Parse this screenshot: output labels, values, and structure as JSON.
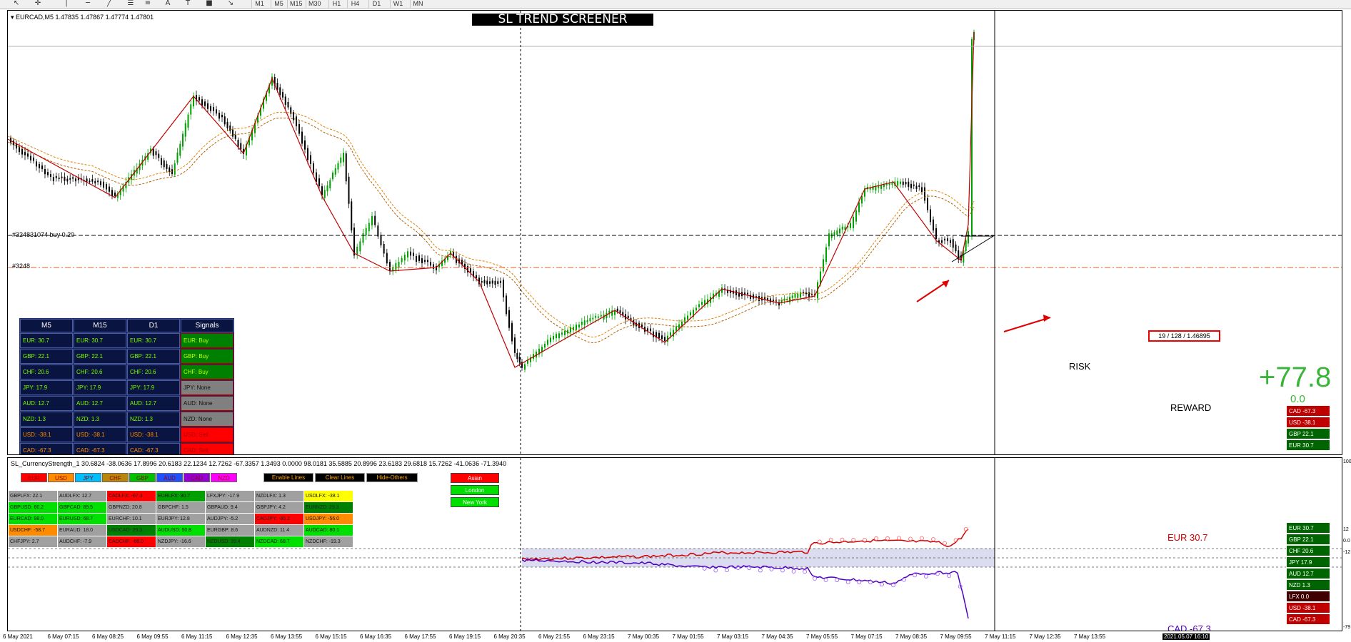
{
  "toolbar": {
    "tools": [
      {
        "icon": "cursor-icon",
        "glyph": "↖"
      },
      {
        "icon": "crosshair-icon",
        "glyph": "✛"
      },
      {
        "icon": "vertical-line-icon",
        "glyph": "│"
      },
      {
        "icon": "horizontal-line-icon",
        "glyph": "─"
      },
      {
        "icon": "trendline-icon",
        "glyph": "╱"
      },
      {
        "icon": "fibonacci-icon",
        "glyph": "☰"
      },
      {
        "icon": "channel-icon",
        "glyph": "≡"
      },
      {
        "icon": "text-icon",
        "glyph": "A"
      },
      {
        "icon": "label-icon",
        "glyph": "T"
      },
      {
        "icon": "shapes-icon",
        "glyph": "■"
      },
      {
        "icon": "arrows-icon",
        "glyph": "↘"
      }
    ],
    "timeframes": [
      "M1",
      "M5",
      "M15",
      "M30",
      "H1",
      "H4",
      "D1",
      "W1",
      "MN"
    ]
  },
  "main": {
    "symbol_info": "▾ EURCAD,M5  1.47835 1.47867 1.47774 1.47801",
    "screener_title": "SL TREND SCREENER",
    "order_buy_label": "#324831074 buy 0.20",
    "order_sl_label": "#3248",
    "risk_box_text": "19 / 128 / 1.46895",
    "risk_label": "RISK",
    "reward_label": "REWARD",
    "profit_value": "+77.8",
    "profit_sub": "0.0"
  },
  "signals_table": {
    "headers": [
      "M5",
      "M15",
      "D1",
      "Signals"
    ],
    "rows": [
      {
        "m5": "EUR: 30.7",
        "m15": "EUR: 30.7",
        "d1": "EUR: 30.7",
        "signal": "EUR: Buy",
        "signal_color": "#008000"
      },
      {
        "m5": "GBP: 22.1",
        "m15": "GBP: 22.1",
        "d1": "GBP: 22.1",
        "signal": "GBP: Buy",
        "signal_color": "#008000"
      },
      {
        "m5": "CHF: 20.6",
        "m15": "CHF: 20.6",
        "d1": "CHF: 20.6",
        "signal": "CHF: Buy",
        "signal_color": "#008000"
      },
      {
        "m5": "JPY: 17.9",
        "m15": "JPY: 17.9",
        "d1": "JPY: 17.9",
        "signal": "JPY: None",
        "signal_color": "#808080"
      },
      {
        "m5": "AUD: 12.7",
        "m15": "AUD: 12.7",
        "d1": "AUD: 12.7",
        "signal": "AUD: None",
        "signal_color": "#808080"
      },
      {
        "m5": "NZD: 1.3",
        "m15": "NZD: 1.3",
        "d1": "NZD: 1.3",
        "signal": "NZD: None",
        "signal_color": "#808080"
      },
      {
        "m5": "USD: -38.1",
        "m15": "USD: -38.1",
        "d1": "USD: -38.1",
        "signal": "USD: Sell",
        "signal_color": "#ff0000"
      },
      {
        "m5": "CAD: -67.3",
        "m15": "CAD: -67.3",
        "d1": "CAD: -67.3",
        "signal": "CAD: Sell",
        "signal_color": "#ff0000"
      }
    ]
  },
  "strength_panel_main": [
    {
      "label": "CAD  -67.3",
      "color": "#c00000"
    },
    {
      "label": "USD  -38.1",
      "color": "#c00000"
    },
    {
      "label": "GBP  22.1",
      "color": "#006400"
    },
    {
      "label": "EUR  30.7",
      "color": "#006400"
    }
  ],
  "strength_panel_sub": [
    {
      "label": "EUR  30.7",
      "color": "#006400"
    },
    {
      "label": "GBP  22.1",
      "color": "#006400"
    },
    {
      "label": "CHF  20.6",
      "color": "#006400"
    },
    {
      "label": "JPY  17.9",
      "color": "#006400"
    },
    {
      "label": "AUD  12.7",
      "color": "#006400"
    },
    {
      "label": "NZD  1.3",
      "color": "#006400"
    },
    {
      "label": "LFX  0.0",
      "color": "#400000"
    },
    {
      "label": "USD  -38.1",
      "color": "#c00000"
    },
    {
      "label": "CAD  -67.3",
      "color": "#c00000"
    }
  ],
  "sub": {
    "info": "SL_CurrencyStrength_1 30.6824 -38.0636 17.8996 20.6183 22.1234 12.7262 -67.3357 1.3493 0.0000 98.0181 35.5885 20.8996 23.6183 29.6818 15.7262 -41.0636 -71.3940",
    "currency_buttons": [
      {
        "label": "EUR",
        "color": "#ff0000"
      },
      {
        "label": "USD",
        "color": "#ff8c00"
      },
      {
        "label": "JPY",
        "color": "#00bfff"
      },
      {
        "label": "CHF",
        "color": "#b8860b"
      },
      {
        "label": "GBP",
        "color": "#00c000"
      },
      {
        "label": "AUD",
        "color": "#1e50ff"
      },
      {
        "label": "CAD",
        "color": "#9400d3"
      },
      {
        "label": "NZD",
        "color": "#ff00ff"
      }
    ],
    "control_buttons": [
      "Enable Lines",
      "Clear Lines",
      "Hide-Others"
    ],
    "sessions": [
      {
        "label": "Asian",
        "color": "#ff0000"
      },
      {
        "label": "London",
        "color": "#00e000"
      },
      {
        "label": "New York",
        "color": "#00e000"
      }
    ],
    "pairs": [
      [
        {
          "t": "GBPLFX: 22.1",
          "c": "#a0a0a0"
        },
        {
          "t": "AUDLFX: 12.7",
          "c": "#a0a0a0"
        },
        {
          "t": "CADLFX: -67.3",
          "c": "#ff0000"
        },
        {
          "t": "EURLFX: 30.7",
          "c": "#00a000"
        },
        {
          "t": "LFXJPY: -17.9",
          "c": "#a0a0a0"
        },
        {
          "t": "NZDLFX: 1.3",
          "c": "#a0a0a0"
        },
        {
          "t": "USDLFX: -38.1",
          "c": "#ffff00"
        }
      ],
      [
        {
          "t": "GBPUSD: 60.2",
          "c": "#00e000"
        },
        {
          "t": "GBPCAD: 89.5",
          "c": "#00e000"
        },
        {
          "t": "GBPNZD: 20.8",
          "c": "#a0a0a0"
        },
        {
          "t": "GBPCHF: 1.5",
          "c": "#a0a0a0"
        },
        {
          "t": "GBPAUD: 9.4",
          "c": "#a0a0a0"
        },
        {
          "t": "GBPJPY: 4.2",
          "c": "#a0a0a0"
        },
        {
          "t": "EURNZD: 29.3",
          "c": "#008000"
        }
      ],
      [
        {
          "t": "EURCAD: 98.0",
          "c": "#00e000"
        },
        {
          "t": "EURUSD: 68.7",
          "c": "#00e000"
        },
        {
          "t": "EURCHF: 10.1",
          "c": "#a0a0a0"
        },
        {
          "t": "EURJPY: 12.8",
          "c": "#a0a0a0"
        },
        {
          "t": "AUDJPY: -5.2",
          "c": "#a0a0a0"
        },
        {
          "t": "CADJPY: -85.2",
          "c": "#ff0000"
        },
        {
          "t": "USDJPY: -56.0",
          "c": "#ff8c00"
        }
      ],
      [
        {
          "t": "USDCHF: -58.7",
          "c": "#ff8c00"
        },
        {
          "t": "EURAUD: 18.0",
          "c": "#a0a0a0"
        },
        {
          "t": "USDCAD: 29.3",
          "c": "#008000"
        },
        {
          "t": "AUDUSD: 50.8",
          "c": "#00e000"
        },
        {
          "t": "EURGBP: 8.6",
          "c": "#a0a0a0"
        },
        {
          "t": "AUDNZD: 11.4",
          "c": "#a0a0a0"
        },
        {
          "t": "AUDCAD: 80.1",
          "c": "#00e000"
        }
      ],
      [
        {
          "t": "CHFJPY: 2.7",
          "c": "#a0a0a0"
        },
        {
          "t": "AUDCHF: -7.9",
          "c": "#a0a0a0"
        },
        {
          "t": "CADCHF: -88.0",
          "c": "#ff0000"
        },
        {
          "t": "NZDJPY: -16.6",
          "c": "#a0a0a0"
        },
        {
          "t": "NZDUSD: 39.4",
          "c": "#008000"
        },
        {
          "t": "NZDCAD: 68.7",
          "c": "#00e000"
        },
        {
          "t": "NZDCHF: -19.3",
          "c": "#a0a0a0"
        }
      ]
    ],
    "eur_label": "EUR  30.7",
    "cad_label": "CAD  -67.3",
    "axis_labels": [
      "100",
      "12",
      "0.0",
      "-12",
      "-79"
    ]
  },
  "time_axis": [
    "6 May 2021",
    "6 May 07:15",
    "6 May 08:25",
    "6 May 09:55",
    "6 May 11:15",
    "6 May 12:35",
    "6 May 13:55",
    "6 May 15:15",
    "6 May 16:35",
    "6 May 17:55",
    "6 May 19:15",
    "6 May 20:35",
    "6 May 21:55",
    "6 May 23:15",
    "7 May 00:35",
    "7 May 01:55",
    "7 May 03:15",
    "7 May 04:35",
    "7 May 05:55",
    "7 May 07:15",
    "7 May 08:35",
    "7 May 09:55",
    "7 May 11:15",
    "7 May 12:35",
    "7 May 13:55",
    "2021.05.07 16:10"
  ],
  "colors": {
    "trend_line": "#c00000",
    "ma_line": "#e08000",
    "bull_candle": "#00a000",
    "bear_candle": "#000000",
    "eur_line": "#d00000",
    "cad_line": "#5000c0",
    "session_band": "#dcdcf0"
  }
}
